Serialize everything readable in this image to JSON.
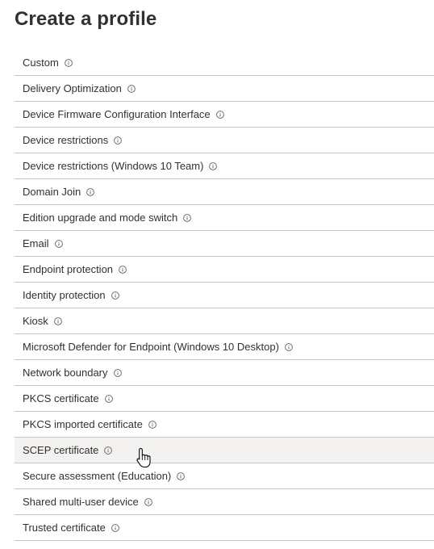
{
  "page": {
    "title": "Create a profile"
  },
  "profiles": [
    {
      "label": "Custom"
    },
    {
      "label": "Delivery Optimization"
    },
    {
      "label": "Device Firmware Configuration Interface"
    },
    {
      "label": "Device restrictions"
    },
    {
      "label": "Device restrictions (Windows 10 Team)"
    },
    {
      "label": "Domain Join"
    },
    {
      "label": "Edition upgrade and mode switch"
    },
    {
      "label": "Email"
    },
    {
      "label": "Endpoint protection"
    },
    {
      "label": "Identity protection"
    },
    {
      "label": "Kiosk"
    },
    {
      "label": "Microsoft Defender for Endpoint (Windows 10 Desktop)"
    },
    {
      "label": "Network boundary"
    },
    {
      "label": "PKCS certificate"
    },
    {
      "label": "PKCS imported certificate"
    },
    {
      "label": "SCEP certificate",
      "hovered": true
    },
    {
      "label": "Secure assessment (Education)"
    },
    {
      "label": "Shared multi-user device"
    },
    {
      "label": "Trusted certificate"
    }
  ],
  "icons": {
    "row_info": "info-icon",
    "pointer": "hand-pointer-cursor-icon"
  },
  "colors": {
    "text": "#323130",
    "divider": "#c8c6c4",
    "hover_row": "#f3f2f1"
  }
}
